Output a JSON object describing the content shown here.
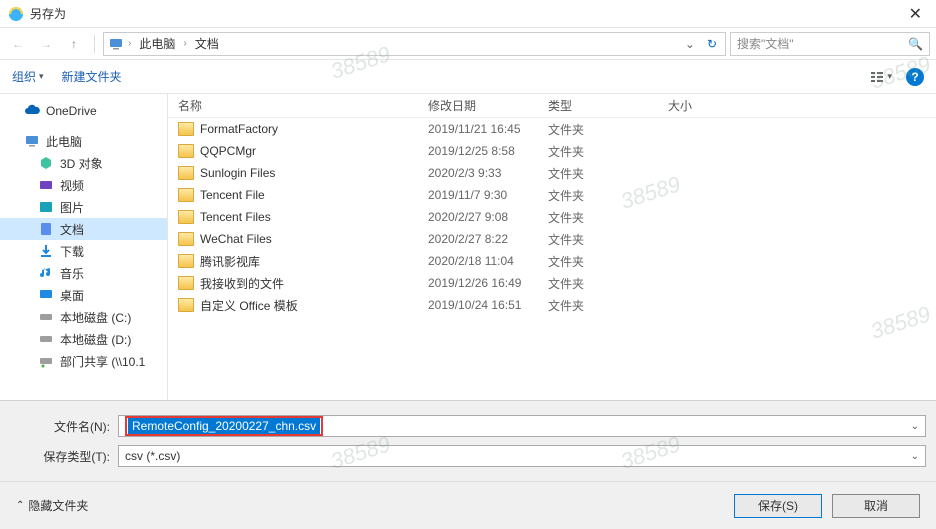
{
  "window": {
    "title": "另存为"
  },
  "breadcrumb": {
    "root": "此电脑",
    "folder": "文档"
  },
  "search": {
    "placeholder": "搜索\"文档\""
  },
  "toolbar": {
    "organize": "组织",
    "new_folder": "新建文件夹"
  },
  "columns": {
    "name": "名称",
    "date": "修改日期",
    "type": "类型",
    "size": "大小"
  },
  "tree": {
    "onedrive": "OneDrive",
    "thispc": "此电脑",
    "items": [
      {
        "label": "3D 对象"
      },
      {
        "label": "视频"
      },
      {
        "label": "图片"
      },
      {
        "label": "文档"
      },
      {
        "label": "下载"
      },
      {
        "label": "音乐"
      },
      {
        "label": "桌面"
      },
      {
        "label": "本地磁盘 (C:)"
      },
      {
        "label": "本地磁盘 (D:)"
      },
      {
        "label": "部门共享 (\\\\10.1"
      }
    ]
  },
  "files": [
    {
      "name": "FormatFactory",
      "date": "2019/11/21 16:45",
      "type": "文件夹"
    },
    {
      "name": "QQPCMgr",
      "date": "2019/12/25 8:58",
      "type": "文件夹"
    },
    {
      "name": "Sunlogin Files",
      "date": "2020/2/3 9:33",
      "type": "文件夹"
    },
    {
      "name": "Tencent File",
      "date": "2019/11/7 9:30",
      "type": "文件夹"
    },
    {
      "name": "Tencent Files",
      "date": "2020/2/27 9:08",
      "type": "文件夹"
    },
    {
      "name": "WeChat Files",
      "date": "2020/2/27 8:22",
      "type": "文件夹"
    },
    {
      "name": "腾讯影视库",
      "date": "2020/2/18 11:04",
      "type": "文件夹"
    },
    {
      "name": "我接收到的文件",
      "date": "2019/12/26 16:49",
      "type": "文件夹"
    },
    {
      "name": "自定义 Office 模板",
      "date": "2019/10/24 16:51",
      "type": "文件夹"
    }
  ],
  "form": {
    "filename_label": "文件名(N):",
    "filename_value": "RemoteConfig_20200227_chn.csv",
    "filetype_label": "保存类型(T):",
    "filetype_value": "csv (*.csv)"
  },
  "footer": {
    "hide_folders": "隐藏文件夹",
    "save": "保存(S)",
    "cancel": "取消"
  },
  "watermark": "38589"
}
